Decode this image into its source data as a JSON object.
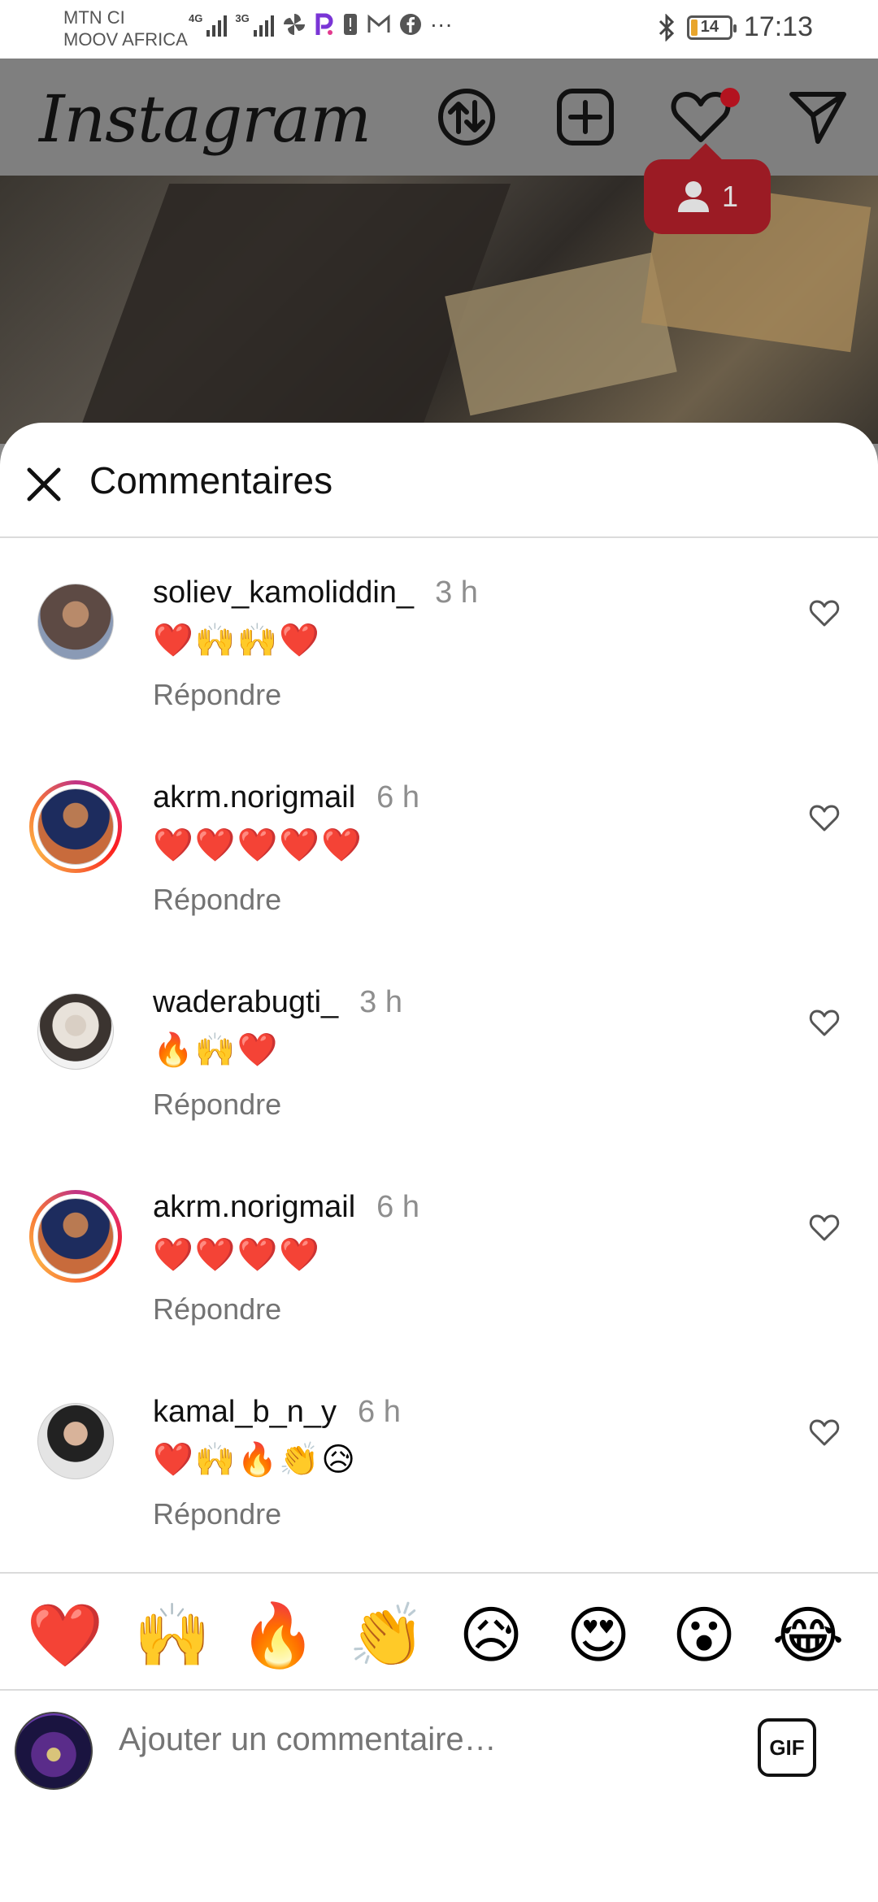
{
  "status_bar": {
    "carrier_line1": "MTN CI",
    "carrier_line2": "MOOV AFRICA",
    "sig1_tag": "4G",
    "sig2_tag": "3G",
    "battery": "14",
    "time": "17:13",
    "more": "···"
  },
  "header": {
    "logo": "Instagram",
    "activity_count": "1"
  },
  "sheet": {
    "title": "Commentaires"
  },
  "comments": [
    {
      "user": "soliev_kamoliddin_",
      "time": "3 h",
      "text": "❤️🙌🙌❤️",
      "reply": "Répondre"
    },
    {
      "user": "akrm.norigmail",
      "time": "6 h",
      "text": "❤️❤️❤️❤️❤️",
      "reply": "Répondre"
    },
    {
      "user": "waderabugti_",
      "time": "3 h",
      "text": "🔥🙌❤️",
      "reply": "Répondre"
    },
    {
      "user": "akrm.norigmail",
      "time": "6 h",
      "text": "❤️❤️❤️❤️",
      "reply": "Répondre"
    },
    {
      "user": "kamal_b_n_y",
      "time": "6 h",
      "text": "❤️🙌🔥👏😥",
      "reply": "Répondre"
    }
  ],
  "reactions": [
    "❤️",
    "🙌",
    "🔥",
    "👏",
    "😥",
    "😍",
    "😮",
    "😂"
  ],
  "composer": {
    "placeholder": "Ajouter un commentaire…",
    "gif_label": "GIF"
  }
}
